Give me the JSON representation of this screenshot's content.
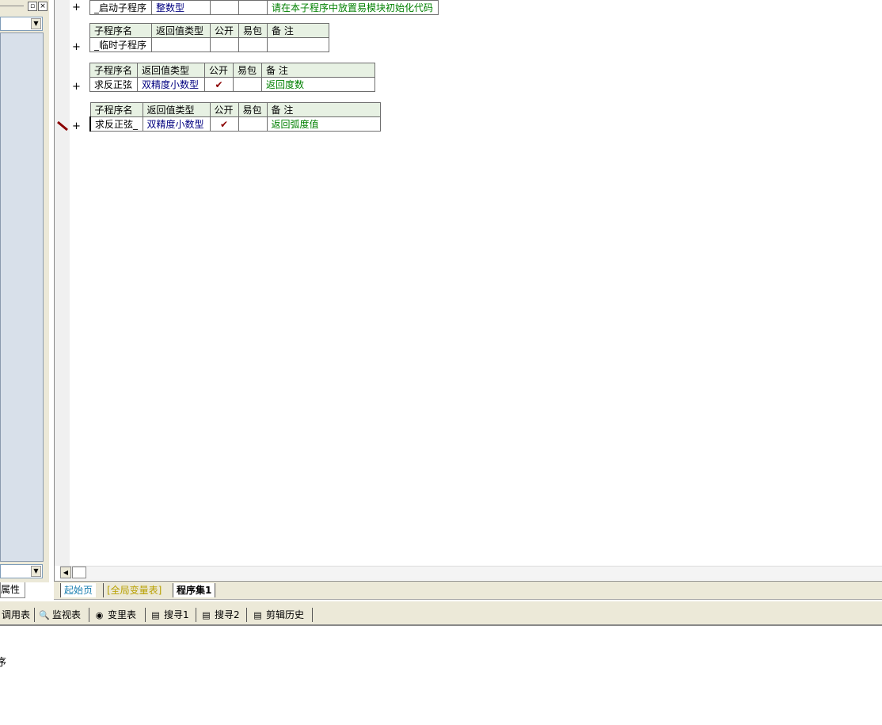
{
  "left_panel": {
    "mini_buttons": [
      "▫",
      "×"
    ],
    "combo_arrow": "▼",
    "tab_label": "属性"
  },
  "subroutines": [
    {
      "name": "_启动子程序",
      "return_type": "整数型",
      "public": "",
      "easy_pack": "",
      "note": "请在本子程序中放置易模块初始化代码",
      "header_visible": false,
      "plus": "+"
    },
    {
      "headers": [
        "子程序名",
        "返回值类型",
        "公开",
        "易包",
        "备 注"
      ],
      "name": "_临时子程序",
      "return_type": "",
      "public": "",
      "easy_pack": "",
      "note": "",
      "plus": "+"
    },
    {
      "headers": [
        "子程序名",
        "返回值类型",
        "公开",
        "易包",
        "备 注"
      ],
      "name": "求反正弦",
      "return_type": "双精度小数型",
      "public": "✔",
      "easy_pack": "",
      "note": "返回度数",
      "plus": "+"
    },
    {
      "headers": [
        "子程序名",
        "返回值类型",
        "公开",
        "易包",
        "备 注"
      ],
      "name": "求反正弦_",
      "return_type": "双精度小数型",
      "public": "✔",
      "easy_pack": "",
      "note": "返回弧度值",
      "plus": "+"
    }
  ],
  "editor_tabs": [
    {
      "label": "起始页",
      "color": "#1a7fb0"
    },
    {
      "label": "[全局变量表]",
      "color": "#b8a000"
    },
    {
      "label": "程序集1",
      "color": "#000000"
    }
  ],
  "bottom_tools": [
    {
      "label": "调用表",
      "icon": ""
    },
    {
      "label": "监视表",
      "icon": "magnifier-icon"
    },
    {
      "label": "变里表",
      "icon": "binoculars-icon"
    },
    {
      "label": "搜寻1",
      "icon": "search-doc-icon"
    },
    {
      "label": "搜寻2",
      "icon": "search-doc-icon"
    },
    {
      "label": "剪辑历史",
      "icon": "clipboard-icon"
    }
  ],
  "output_text": "序",
  "scroll_arrow": "◀"
}
